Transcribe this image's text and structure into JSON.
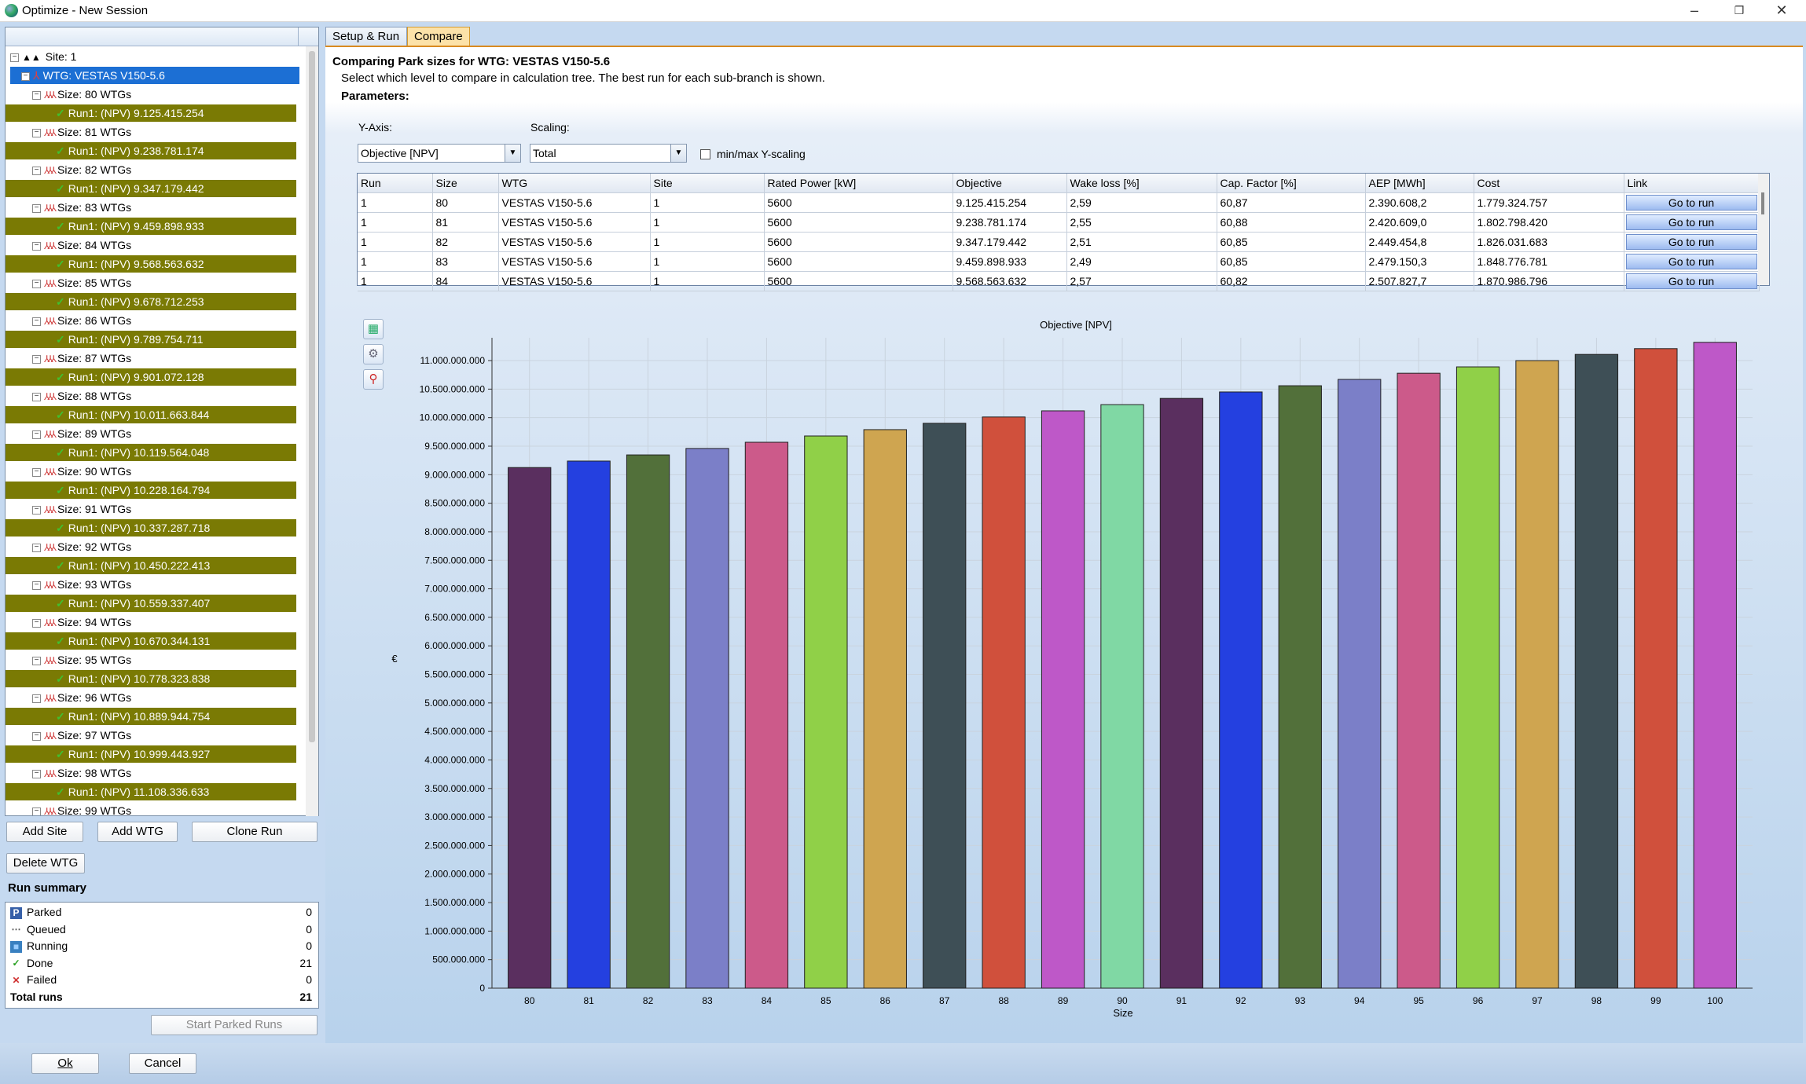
{
  "window": {
    "title": "Optimize - New Session"
  },
  "tree": {
    "site": "Site: 1",
    "wtg": "WTG: VESTAS V150-5.6",
    "sizes": [
      {
        "size": "Size: 80 WTGs",
        "run": "Run1: (NPV) 9.125.415.254"
      },
      {
        "size": "Size: 81 WTGs",
        "run": "Run1: (NPV) 9.238.781.174"
      },
      {
        "size": "Size: 82 WTGs",
        "run": "Run1: (NPV) 9.347.179.442"
      },
      {
        "size": "Size: 83 WTGs",
        "run": "Run1: (NPV) 9.459.898.933"
      },
      {
        "size": "Size: 84 WTGs",
        "run": "Run1: (NPV) 9.568.563.632"
      },
      {
        "size": "Size: 85 WTGs",
        "run": "Run1: (NPV) 9.678.712.253"
      },
      {
        "size": "Size: 86 WTGs",
        "run": "Run1: (NPV) 9.789.754.711"
      },
      {
        "size": "Size: 87 WTGs",
        "run": "Run1: (NPV) 9.901.072.128"
      },
      {
        "size": "Size: 88 WTGs",
        "run": "Run1: (NPV) 10.011.663.844"
      },
      {
        "size": "Size: 89 WTGs",
        "run": "Run1: (NPV) 10.119.564.048"
      },
      {
        "size": "Size: 90 WTGs",
        "run": "Run1: (NPV) 10.228.164.794"
      },
      {
        "size": "Size: 91 WTGs",
        "run": "Run1: (NPV) 10.337.287.718"
      },
      {
        "size": "Size: 92 WTGs",
        "run": "Run1: (NPV) 10.450.222.413"
      },
      {
        "size": "Size: 93 WTGs",
        "run": "Run1: (NPV) 10.559.337.407"
      },
      {
        "size": "Size: 94 WTGs",
        "run": "Run1: (NPV) 10.670.344.131"
      },
      {
        "size": "Size: 95 WTGs",
        "run": "Run1: (NPV) 10.778.323.838"
      },
      {
        "size": "Size: 96 WTGs",
        "run": "Run1: (NPV) 10.889.944.754"
      },
      {
        "size": "Size: 97 WTGs",
        "run": "Run1: (NPV) 10.999.443.927"
      },
      {
        "size": "Size: 98 WTGs",
        "run": "Run1: (NPV) 11.108.336.633"
      },
      {
        "size": "Size: 99 WTGs",
        "run": ""
      }
    ]
  },
  "buttons": {
    "add_site": "Add Site",
    "add_wtg": "Add WTG",
    "clone_run": "Clone Run",
    "delete_wtg": "Delete WTG",
    "start_parked": "Start Parked Runs",
    "ok": "Ok",
    "cancel": "Cancel"
  },
  "summary": {
    "title": "Run summary",
    "rows": [
      {
        "label": "Parked",
        "value": "0",
        "icon": "parked-icon"
      },
      {
        "label": "Queued",
        "value": "0",
        "icon": "queued-icon"
      },
      {
        "label": "Running",
        "value": "0",
        "icon": "running-icon"
      },
      {
        "label": "Done",
        "value": "21",
        "icon": "done-check-icon"
      },
      {
        "label": "Failed",
        "value": "0",
        "icon": "failed-x-icon"
      },
      {
        "label": "Total runs",
        "value": "21",
        "icon": ""
      }
    ]
  },
  "tabs": [
    {
      "label": "Setup & Run"
    },
    {
      "label": "Compare"
    }
  ],
  "compare": {
    "heading": "Comparing Park sizes for WTG: VESTAS V150-5.6",
    "subtext": "Select which level to compare in calculation tree. The best run for each sub-branch is shown.",
    "parameters": "Parameters:",
    "yaxis_label": "Y-Axis:",
    "yaxis_value": "Objective [NPV]",
    "scaling_label": "Scaling:",
    "scaling_value": "Total",
    "minmax_label": "min/max Y-scaling"
  },
  "grid": {
    "columns": [
      "Run",
      "Size",
      "WTG",
      "Site",
      "Rated Power [kW]",
      "Objective",
      "Wake loss [%]",
      "Cap. Factor [%]",
      "AEP [MWh]",
      "Cost",
      "Link"
    ],
    "rows": [
      [
        "1",
        "80",
        "VESTAS V150-5.6",
        "1",
        "5600",
        "9.125.415.254",
        "2,59",
        "60,87",
        "2.390.608,2",
        "1.779.324.757",
        "Go to run"
      ],
      [
        "1",
        "81",
        "VESTAS V150-5.6",
        "1",
        "5600",
        "9.238.781.174",
        "2,55",
        "60,88",
        "2.420.609,0",
        "1.802.798.420",
        "Go to run"
      ],
      [
        "1",
        "82",
        "VESTAS V150-5.6",
        "1",
        "5600",
        "9.347.179.442",
        "2,51",
        "60,85",
        "2.449.454,8",
        "1.826.031.683",
        "Go to run"
      ],
      [
        "1",
        "83",
        "VESTAS V150-5.6",
        "1",
        "5600",
        "9.459.898.933",
        "2,49",
        "60,85",
        "2.479.150,3",
        "1.848.776.781",
        "Go to run"
      ],
      [
        "1",
        "84",
        "VESTAS V150-5.6",
        "1",
        "5600",
        "9.568.563.632",
        "2,57",
        "60,82",
        "2.507.827,7",
        "1.870.986.796",
        "Go to run"
      ]
    ]
  },
  "chart_data": {
    "type": "bar",
    "title": "Objective [NPV]",
    "xlabel": "Size",
    "ylabel": "€",
    "ylim": [
      0,
      11400000000
    ],
    "ytick_labels": [
      "0",
      "500.000.000",
      "1.000.000.000",
      "1.500.000.000",
      "2.000.000.000",
      "2.500.000.000",
      "3.000.000.000",
      "3.500.000.000",
      "4.000.000.000",
      "4.500.000.000",
      "5.000.000.000",
      "5.500.000.000",
      "6.000.000.000",
      "6.500.000.000",
      "7.000.000.000",
      "7.500.000.000",
      "8.000.000.000",
      "8.500.000.000",
      "9.000.000.000",
      "9.500.000.000",
      "10.000.000.000",
      "10.500.000.000",
      "11.000.000.000"
    ],
    "categories": [
      "80",
      "81",
      "82",
      "83",
      "84",
      "85",
      "86",
      "87",
      "88",
      "89",
      "90",
      "91",
      "92",
      "93",
      "94",
      "95",
      "96",
      "97",
      "98",
      "99",
      "100"
    ],
    "values": [
      9125415254,
      9238781174,
      9347179442,
      9459898933,
      9568563632,
      9678712253,
      9789754711,
      9901072128,
      10011663844,
      10119564048,
      10228164794,
      10337287718,
      10450222413,
      10559337407,
      10670344131,
      10778323838,
      10889944754,
      10999443927,
      11108336633,
      11210000000,
      11320000000
    ],
    "colors": [
      "#5a2f5f",
      "#2440e0",
      "#52703a",
      "#7b7fc8",
      "#cc5a8a",
      "#90d048",
      "#cfa550",
      "#3e4f56",
      "#d0503c",
      "#be58c8",
      "#80d8a4",
      "#5a2f5f",
      "#2440e0",
      "#52703a",
      "#7b7fc8",
      "#cc5a8a",
      "#90d048",
      "#cfa550",
      "#3e4f56",
      "#d0503c",
      "#be58c8"
    ],
    "grid": true
  }
}
